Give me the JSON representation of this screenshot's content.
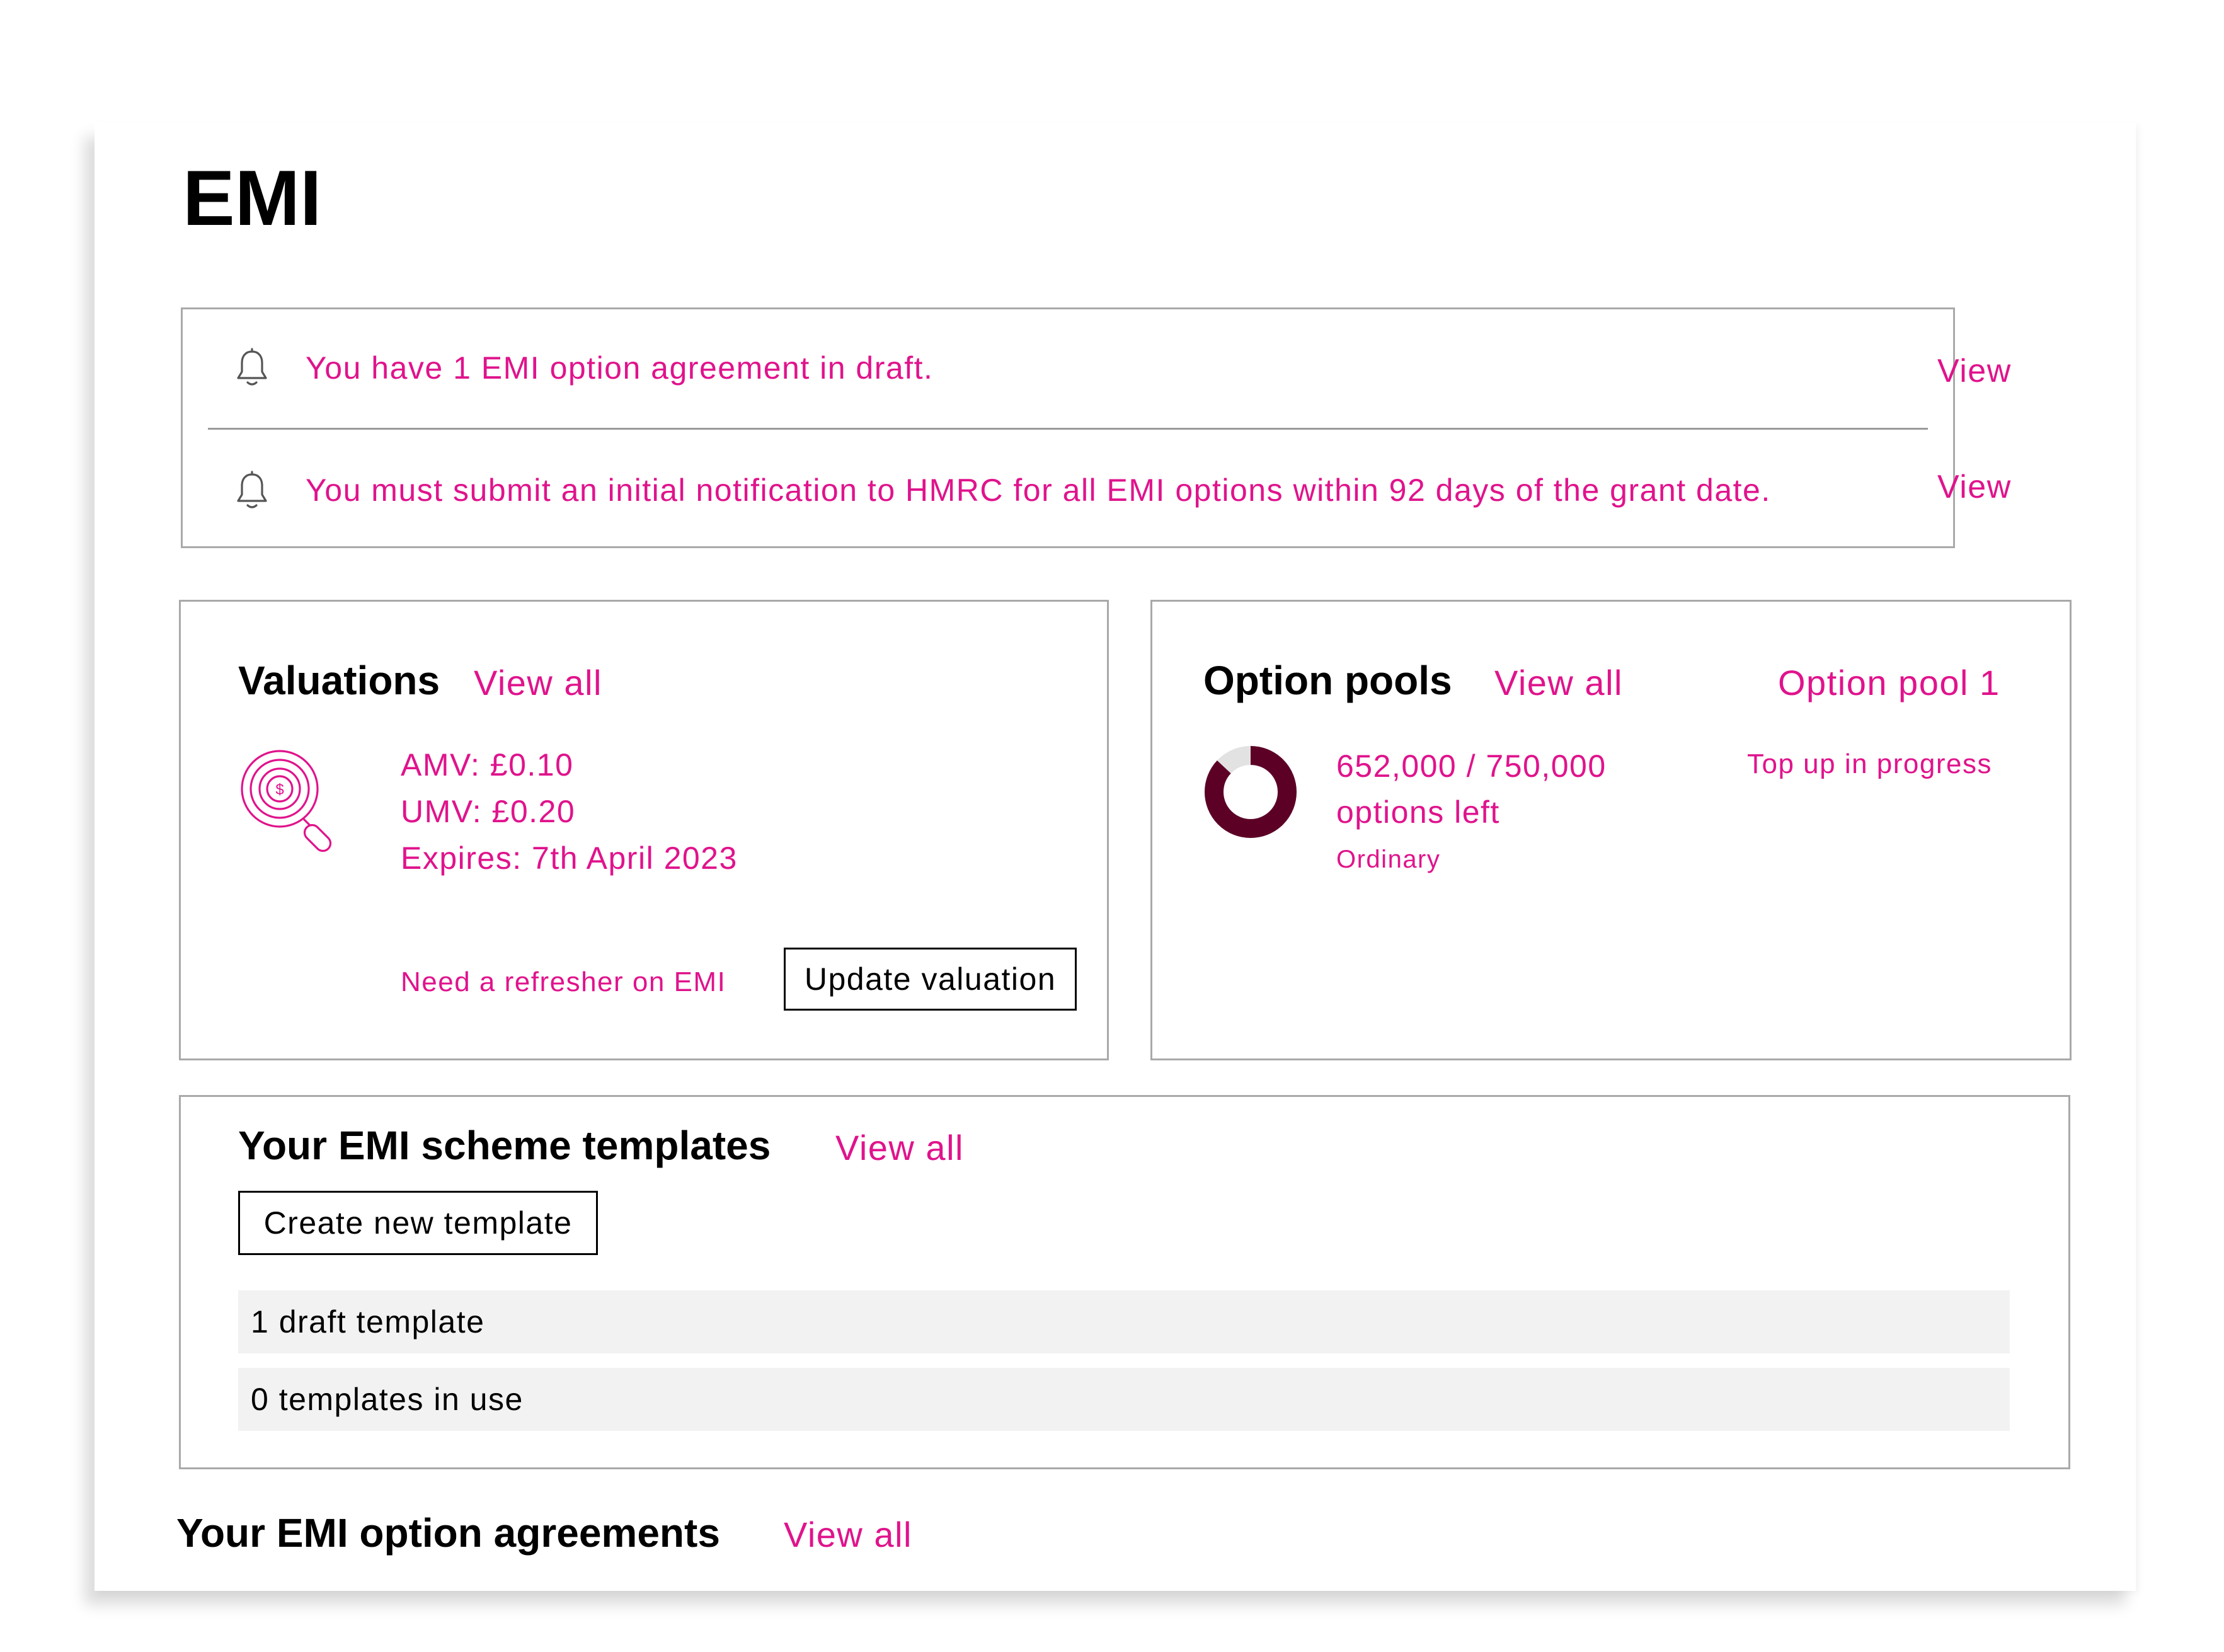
{
  "page": {
    "title": "EMI"
  },
  "notifications": [
    {
      "icon": "bell-icon",
      "text": "You have 1 EMI option agreement in draft.",
      "action": "View"
    },
    {
      "icon": "bell-icon",
      "text": "You must submit an initial notification to HMRC for all EMI options within 92 days of  the grant date.",
      "action": "View"
    }
  ],
  "valuations": {
    "heading": "Valuations",
    "view_all": "View all",
    "icon": "valuation-magnifier-icon",
    "amv": "AMV: £0.10",
    "umv": "UMV: £0.20",
    "expires": "Expires: 7th April 2023",
    "refresher_link": "Need a refresher on EMI",
    "update_button": "Update valuation"
  },
  "option_pools": {
    "heading": "Option pools",
    "view_all": "View all",
    "pool_name": "Option pool 1",
    "status": "Top up in progress",
    "options_count": "652,000 / 750,000",
    "options_left_label": "options left",
    "share_class": "Ordinary",
    "options_remaining": 652000,
    "options_total": 750000,
    "donut_color": "#5c0026",
    "donut_track_color": "#e2e2e2"
  },
  "templates": {
    "heading": "Your EMI scheme templates",
    "view_all": "View all",
    "create_button": "Create new template",
    "rows": [
      "1 draft template",
      "0 templates in use"
    ]
  },
  "agreements": {
    "heading": "Your EMI option agreements",
    "view_all": "View all"
  },
  "colors": {
    "accent": "#e0138c",
    "border": "#a9a9a9",
    "row_background": "#f2f2f2"
  }
}
